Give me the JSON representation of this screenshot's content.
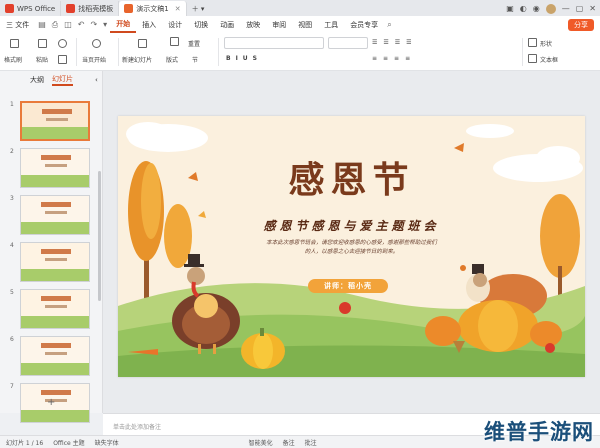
{
  "tabs": [
    {
      "label": "WPS Office",
      "color": "#e2402c"
    },
    {
      "label": "找稻壳模板",
      "color": "#e2402c"
    },
    {
      "label": "演示文稿1",
      "color": "#e8642c"
    }
  ],
  "menu": {
    "file": "三 文件",
    "items": [
      "开始",
      "插入",
      "设计",
      "切换",
      "动画",
      "放映",
      "审阅",
      "视图",
      "工具",
      "会员专享"
    ],
    "active_index": 0,
    "share": "分享"
  },
  "ribbon": {
    "format_painter": "格式刷",
    "paste": "粘贴",
    "play": "当页开始",
    "new_slide": "新建幻灯片",
    "layout": "版式",
    "section": "节",
    "reset": "重置",
    "shape": "形状",
    "textbox": "文本框"
  },
  "left_panel": {
    "tabs": [
      "大纲",
      "幻灯片"
    ],
    "active_tab": 1,
    "slide_numbers": [
      "1",
      "2",
      "3",
      "4",
      "5",
      "6",
      "7"
    ],
    "add_symbol": "+"
  },
  "slide": {
    "title": "感恩节",
    "subtitle": "感恩节感恩与爱主题班会",
    "body_line1": "本本此次感恩节班会，请您欢迎收感恩的心感受，感谢那些帮助过我们",
    "body_line2": "的人，以感恩之心去迎接节日的到来。",
    "teacher": "讲师：稻小壳"
  },
  "notes_placeholder": "单击此处添加备注",
  "status": {
    "slide_count": "幻灯片 1 / 16",
    "theme": "Office 主题",
    "font": "缺失字体",
    "beautify": "智能美化",
    "notes": "备注",
    "comments": "批注"
  },
  "watermark": "维普手游网",
  "colors": {
    "accent": "#d04a1e",
    "share": "#f05a28",
    "title_brown": "#7a3a1c"
  }
}
